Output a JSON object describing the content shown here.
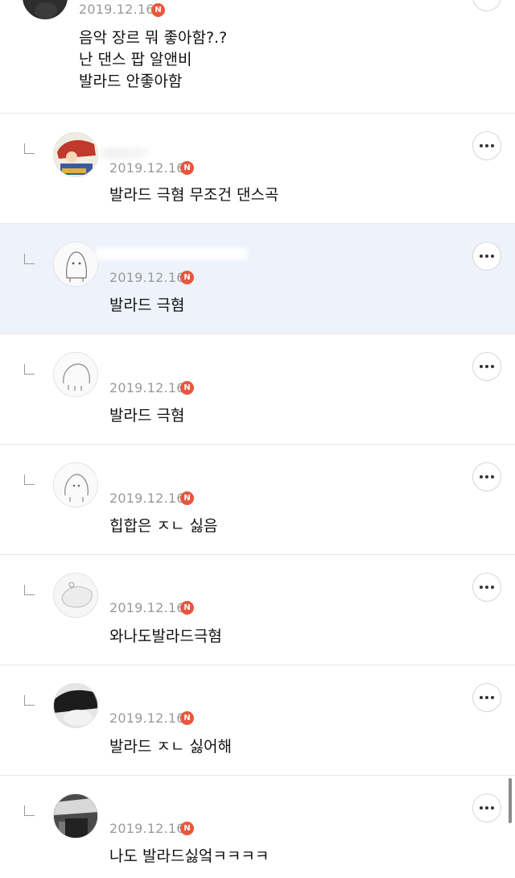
{
  "comments": [
    {
      "date": "2019.12.16",
      "badge": "N",
      "text": "음악 장르 뭐 좋아함?.?\n난 댄스 팝 알앤비\n발라드 안좋아함"
    },
    {
      "date": "2019.12.16",
      "badge": "N",
      "text": "발라드 극혐 무조건 댄스곡"
    },
    {
      "date": "2019.12.16",
      "badge": "N",
      "text": "발라드 극혐"
    },
    {
      "date": "2019.12.16",
      "badge": "N",
      "text": "발라드 극혐"
    },
    {
      "date": "2019.12.16",
      "badge": "N",
      "text": "힙합은 ㅈㄴ 싫음"
    },
    {
      "date": "2019.12.16",
      "badge": "N",
      "text": "와나도발라드극혐"
    },
    {
      "date": "2019.12.16",
      "badge": "N",
      "text": "발라드 ㅈㄴ 싫어해"
    },
    {
      "date": "2019.12.16",
      "badge": "N",
      "text": "나도 발라드싫엌ㅋㅋㅋㅋ"
    }
  ],
  "colors": {
    "badge": "#e8573e",
    "highlight_row": "#eef3fb",
    "date_text": "#9a9a9a"
  },
  "icons": {
    "more": "more-horizontal-icon",
    "reply": "reply-indicator-icon",
    "new": "new-badge-icon"
  }
}
